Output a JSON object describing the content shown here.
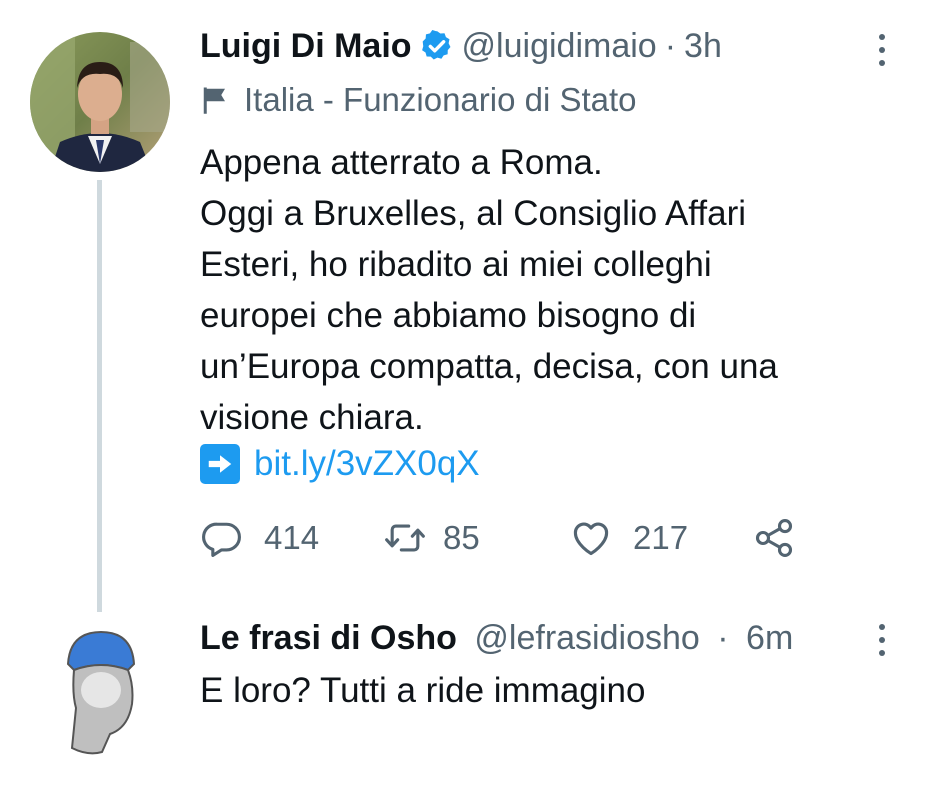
{
  "tweets": [
    {
      "author_name": "Luigi Di Maio",
      "verified": true,
      "handle": "@luigidimaio",
      "time_sep": "·",
      "time": "3h",
      "label": "Italia - Funzionario di Stato",
      "text_lines": [
        "Appena atterrato a Roma.",
        "Oggi a Bruxelles, al Consiglio Affari",
        "Esteri, ho ribadito ai miei colleghi",
        "europei che abbiamo bisogno di",
        "un’Europa compatta, decisa, con una",
        "visione chiara."
      ],
      "link_text": "bit.ly/3vZX0qX",
      "replies": "414",
      "retweets": "85",
      "likes": "217",
      "icons": {
        "verified": "verified-badge-icon",
        "label": "flag-icon",
        "link": "right-arrow-icon",
        "reply": "reply-icon",
        "retweet": "retweet-icon",
        "like": "heart-icon",
        "share": "share-icon",
        "more": "more-vertical-icon"
      }
    },
    {
      "author_name": "Le frasi di Osho",
      "handle": "@lefrasidiosho",
      "time_sep": "·",
      "time": "6m",
      "text": "E loro? Tutti a ride immagino"
    }
  ],
  "colors": {
    "accent": "#1d9bf0",
    "secondary_text": "#536471",
    "primary_text": "#0f1419",
    "thread_line": "#cfd9de"
  }
}
